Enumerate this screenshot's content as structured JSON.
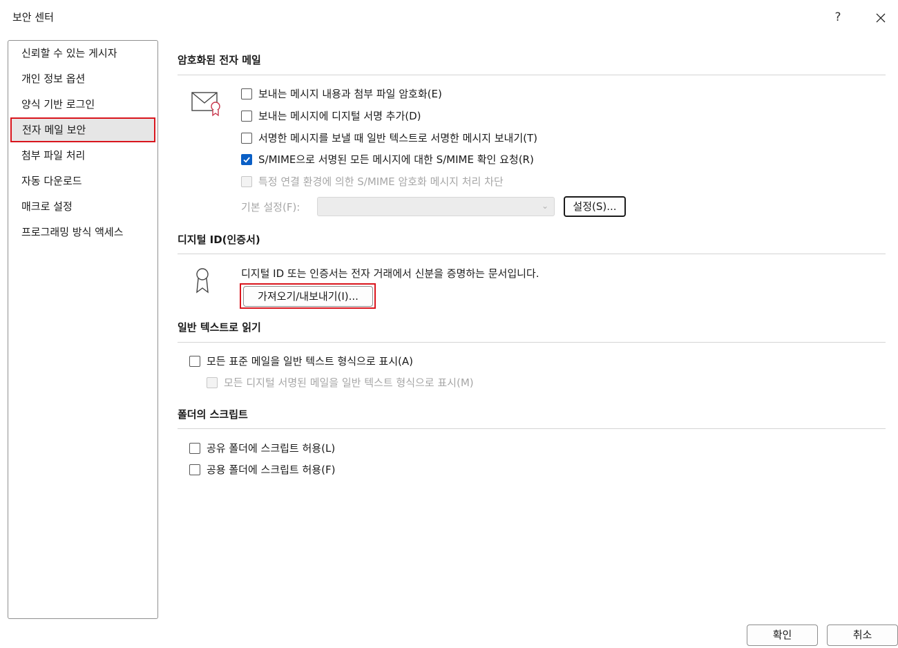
{
  "window": {
    "title": "보안 센터",
    "help_label": "?",
    "close_icon": "close-icon"
  },
  "sidebar": {
    "items": [
      {
        "label": "신뢰할 수 있는 게시자",
        "selected": false
      },
      {
        "label": "개인 정보 옵션",
        "selected": false
      },
      {
        "label": "양식 기반 로그인",
        "selected": false
      },
      {
        "label": "전자 메일 보안",
        "selected": true
      },
      {
        "label": "첨부 파일 처리",
        "selected": false
      },
      {
        "label": "자동 다운로드",
        "selected": false
      },
      {
        "label": "매크로 설정",
        "selected": false
      },
      {
        "label": "프로그래밍 방식 액세스",
        "selected": false
      }
    ]
  },
  "encrypted_email": {
    "header": "암호화된 전자 메일",
    "icon": "envelope-certificate-icon",
    "options": [
      {
        "label": "보내는 메시지 내용과 첨부 파일 암호화(E)",
        "checked": false,
        "disabled": false
      },
      {
        "label": "보내는 메시지에 디지털 서명 추가(D)",
        "checked": false,
        "disabled": false
      },
      {
        "label": "서명한 메시지를 보낼 때 일반 텍스트로 서명한 메시지 보내기(T)",
        "checked": false,
        "disabled": false
      },
      {
        "label": "S/MIME으로 서명된 모든 메시지에 대한 S/MIME 확인 요청(R)",
        "checked": true,
        "disabled": false
      },
      {
        "label": "특정 연결 환경에 의한 S/MIME 암호화 메시지 처리 차단",
        "checked": false,
        "disabled": true
      }
    ],
    "default_setting_label": "기본 설정(F):",
    "default_setting_value": "",
    "settings_button": "설정(S)..."
  },
  "digital_id": {
    "header": "디지털 ID(인증서)",
    "icon": "certificate-ribbon-icon",
    "description": "디지털 ID 또는 인증서는 전자 거래에서 신분을 증명하는 문서입니다.",
    "import_export_button": "가져오기/내보내기(I)..."
  },
  "plain_text": {
    "header": "일반 텍스트로 읽기",
    "options": [
      {
        "label": "모든 표준 메일을 일반 텍스트 형식으로 표시(A)",
        "checked": false,
        "disabled": false
      },
      {
        "label": "모든 디지털 서명된 메일을 일반 텍스트 형식으로 표시(M)",
        "checked": false,
        "disabled": true
      }
    ]
  },
  "folder_script": {
    "header": "폴더의 스크립트",
    "options": [
      {
        "label": "공유 폴더에 스크립트 허용(L)",
        "checked": false,
        "disabled": false
      },
      {
        "label": "공용 폴더에 스크립트 허용(F)",
        "checked": false,
        "disabled": false
      }
    ]
  },
  "footer": {
    "ok_button": "확인",
    "cancel_button": "취소"
  },
  "colors": {
    "accent": "#0a5fc6",
    "highlight": "#d9141c"
  }
}
